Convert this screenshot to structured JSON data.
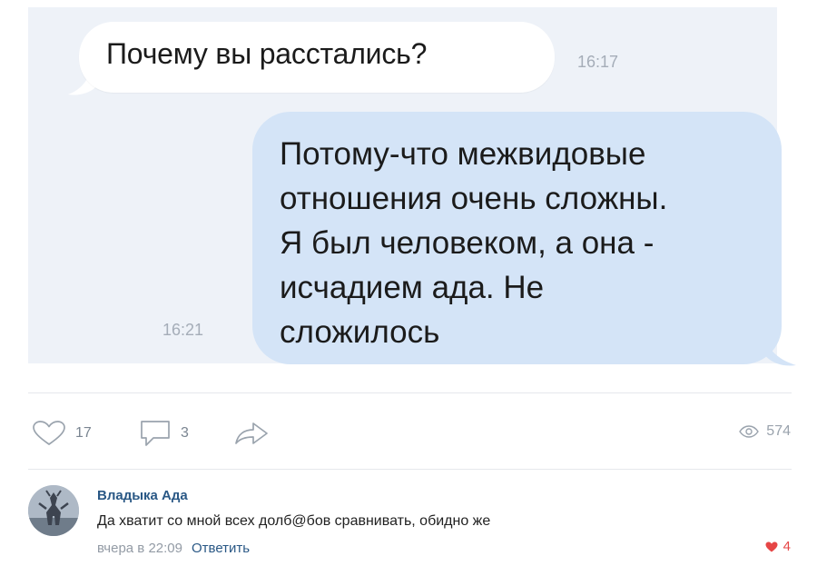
{
  "chat": {
    "incoming": {
      "text": "Почему вы расстались?",
      "time": "16:17"
    },
    "outgoing": {
      "lines": [
        "Потому-что межвидовые",
        "отношения очень сложны.",
        "Я был человеком, а она -",
        "исчадием ада. Не",
        "сложилось"
      ],
      "time": "16:21"
    }
  },
  "post_actions": {
    "likes": "17",
    "comments": "3",
    "views": "574",
    "icons": [
      "heart-icon",
      "comment-icon",
      "share-icon",
      "eye-icon"
    ]
  },
  "comment": {
    "author": "Владыка Ада",
    "text": "Да хватит со мной всех долб@бов сравнивать, обидно же",
    "time": "вчера в 22:09",
    "reply_label": "Ответить",
    "likes": "4"
  },
  "colors": {
    "chat_background": "#eef2f8",
    "incoming_bubble": "#ffffff",
    "outgoing_bubble": "#d4e4f7",
    "link": "#2a5885",
    "like_active": "#e64646"
  }
}
